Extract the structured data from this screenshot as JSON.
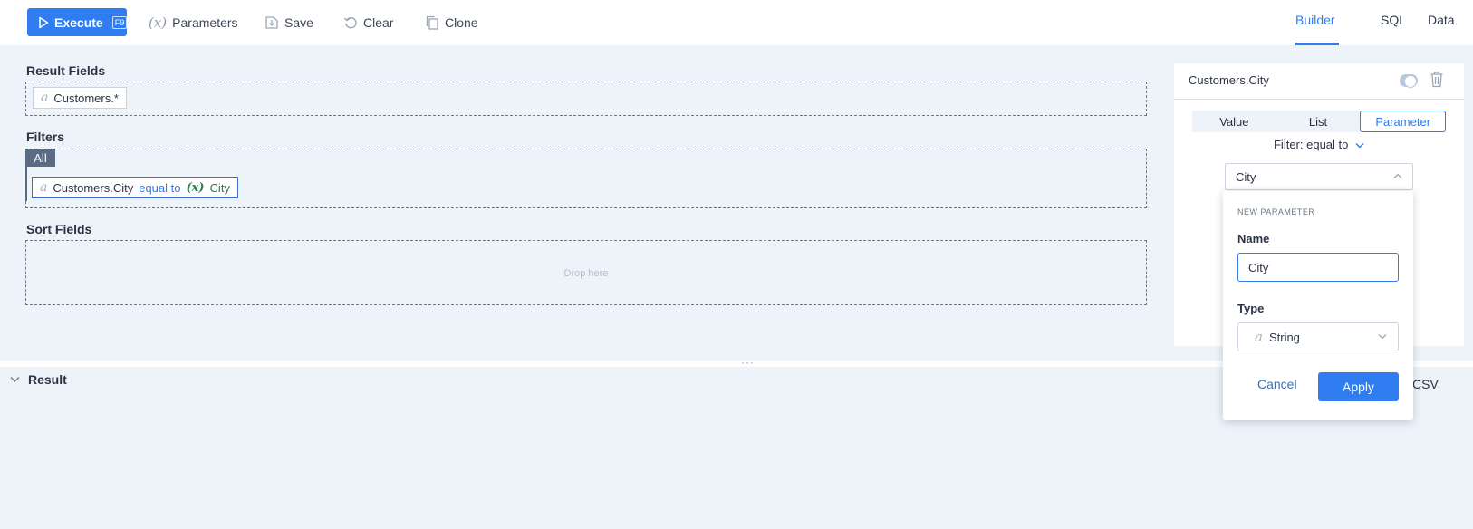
{
  "toolbar": {
    "execute_label": "Execute",
    "execute_key": "F9",
    "parameters_label": "Parameters",
    "save_label": "Save",
    "clear_label": "Clear",
    "clone_label": "Clone"
  },
  "view_tabs": [
    {
      "label": "Builder",
      "active": true
    },
    {
      "label": "SQL",
      "active": false
    },
    {
      "label": "Data",
      "active": false
    }
  ],
  "result_fields": {
    "label": "Result Fields",
    "items": [
      {
        "type_glyph": "a",
        "text": "Customers.*"
      }
    ]
  },
  "filters": {
    "label": "Filters",
    "group": "All",
    "items": [
      {
        "type_glyph": "a",
        "field": "Customers.City",
        "operator": "equal to",
        "param_glyph": "(x)",
        "param": "City"
      }
    ]
  },
  "sort_fields": {
    "label": "Sort Fields",
    "placeholder": "Drop here"
  },
  "result": {
    "label": "Result",
    "csv_text": "CSV"
  },
  "panel": {
    "title": "Customers.City",
    "segments": [
      {
        "label": "Value",
        "active": false
      },
      {
        "label": "List",
        "active": false
      },
      {
        "label": "Parameter",
        "active": true
      }
    ],
    "filter_label": "Filter:",
    "filter_operator": "equal to",
    "selected_param": "City"
  },
  "popup": {
    "caption": "NEW PARAMETER",
    "name_label": "Name",
    "name_value": "City",
    "type_label": "Type",
    "type_glyph": "a",
    "type_value": "String",
    "cancel_label": "Cancel",
    "apply_label": "Apply"
  },
  "colors": {
    "accent": "#2f7df0",
    "param_green": "#2e7a4e",
    "group_badge": "#5a6b85",
    "canvas_bg": "#eef3fa"
  }
}
